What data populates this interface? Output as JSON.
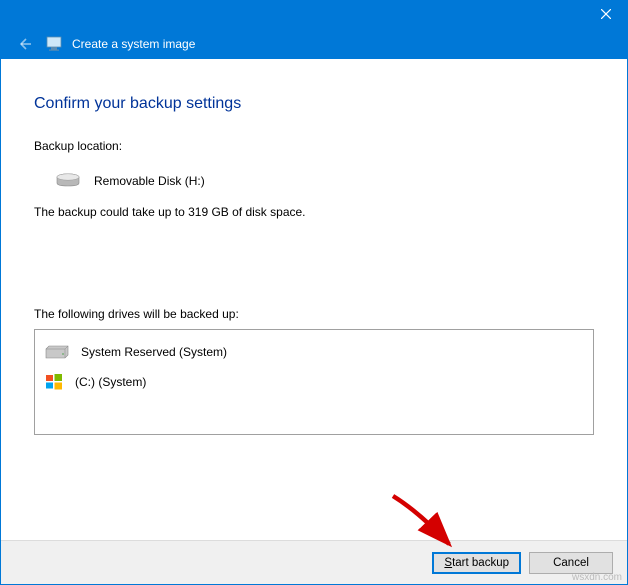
{
  "window": {
    "title": "Create a system image"
  },
  "page": {
    "heading": "Confirm your backup settings",
    "backup_location_label": "Backup location:",
    "backup_location_value": "Removable Disk (H:)",
    "size_note": "The backup could take up to 319 GB of disk space.",
    "drives_label": "The following drives will be backed up:",
    "drives": [
      {
        "icon": "hdd-icon",
        "label": "System Reserved (System)"
      },
      {
        "icon": "windows-icon",
        "label": "(C:) (System)"
      }
    ]
  },
  "footer": {
    "start_label_pre": "S",
    "start_label_post": "tart backup",
    "cancel_label": "Cancel"
  },
  "watermark": "wsxdn.com"
}
